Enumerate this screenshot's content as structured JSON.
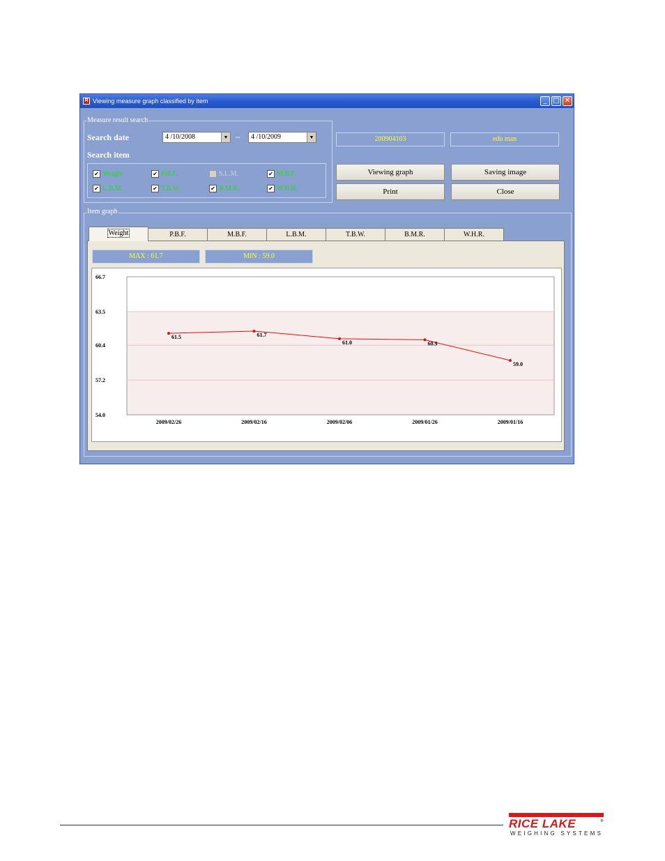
{
  "window": {
    "title": "Viewing measure graph classified by item",
    "icon_letter": "R",
    "controls": {
      "minimize": "_",
      "maximize": "□",
      "close": "✕"
    }
  },
  "search": {
    "group_label": "Measure result search",
    "date_label": "Search date",
    "date_from": "4 /10/2008",
    "date_to": "4 /10/2009",
    "separator": "~",
    "item_label": "Search item",
    "items": [
      {
        "label": "Weight",
        "checked": true,
        "enabled": true
      },
      {
        "label": "P.B.F.",
        "checked": true,
        "enabled": true
      },
      {
        "label": "S.L.M.",
        "checked": false,
        "enabled": false
      },
      {
        "label": "M.B.F.",
        "checked": true,
        "enabled": true
      },
      {
        "label": "L.B.M.",
        "checked": true,
        "enabled": true
      },
      {
        "label": "T.B.W.",
        "checked": true,
        "enabled": true
      },
      {
        "label": "B.M.R.",
        "checked": true,
        "enabled": true
      },
      {
        "label": "W.H.R.",
        "checked": true,
        "enabled": true
      }
    ]
  },
  "user": {
    "id": "200904103",
    "name": "edu man"
  },
  "buttons": {
    "viewing_graph": "Viewing graph",
    "saving_image": "Saving image",
    "print": "Print",
    "close": "Close"
  },
  "graph": {
    "group_label": "Item graph",
    "tabs": [
      "Weight",
      "P.B.F.",
      "M.B.F.",
      "L.B.M.",
      "T.B.W.",
      "B.M.R.",
      "W.H.R."
    ],
    "active_tab": "Weight",
    "max_text": "MAX : 61.7",
    "min_text": "MIN : 59.0"
  },
  "chart_data": {
    "type": "line",
    "categories": [
      "2009/02/26",
      "2009/02/16",
      "2009/02/06",
      "2009/01/26",
      "2009/01/16"
    ],
    "series": [
      {
        "values": [
          61.5,
          61.7,
          61.0,
          60.9,
          59.0
        ],
        "labels": [
          "61.5",
          "61.7",
          "61.0",
          "60.9",
          "59.0"
        ],
        "color": "#e01010"
      }
    ],
    "yticks": [
      "66.7",
      "63.5",
      "60.4",
      "57.2",
      "54.0"
    ],
    "ylim": [
      54.0,
      66.7
    ],
    "grid": true,
    "band_color": "#f8eded",
    "gridline_color": "#e6c6c6"
  },
  "footer": {
    "logo_main": "RICE LAKE",
    "logo_sub": "WEIGHING SYSTEMS",
    "logo_reg": "®",
    "brand_color": "#d01c1f"
  }
}
